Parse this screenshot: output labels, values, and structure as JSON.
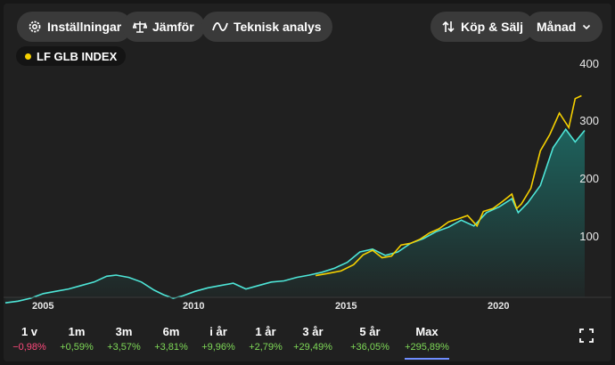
{
  "toolbar": {
    "settings_label": "Inställningar",
    "compare_label": "Jämför",
    "technical_label": "Teknisk analys",
    "buy_sell_label": "Köp & Sälj",
    "interval_label": "Månad"
  },
  "series_label": "LF GLB INDEX",
  "colors": {
    "index_line": "#f5d000",
    "fund_line": "#4ee6d8",
    "fund_fill": "#1d5a56",
    "positive": "#7ed957",
    "negative": "#ff4a7c",
    "active_tab": "#6f8dff"
  },
  "chart_data": {
    "type": "line",
    "y_ticks": [
      "400",
      "300",
      "200",
      "100"
    ],
    "x_ticks": [
      "2005",
      "2010",
      "2015",
      "2020"
    ],
    "ylim": [
      0,
      400
    ],
    "xlim": [
      2004.0,
      2022.3
    ],
    "series": [
      {
        "name": "LF GLB INDEX",
        "color": "#f5d000",
        "x": [
          2013.8,
          2014.2,
          2014.6,
          2015.0,
          2015.3,
          2015.6,
          2015.9,
          2016.2,
          2016.5,
          2016.8,
          2017.1,
          2017.4,
          2017.7,
          2018.0,
          2018.3,
          2018.6,
          2018.9,
          2019.1,
          2019.4,
          2019.7,
          2020.0,
          2020.15,
          2020.3,
          2020.6,
          2020.9,
          2021.2,
          2021.5,
          2021.8,
          2022.0,
          2022.2
        ],
        "values": [
          39,
          43,
          47,
          58,
          75,
          83,
          70,
          73,
          92,
          95,
          102,
          113,
          120,
          132,
          137,
          143,
          125,
          150,
          155,
          167,
          180,
          155,
          163,
          190,
          255,
          283,
          320,
          295,
          345,
          350
        ]
      },
      {
        "series_index": 1,
        "color": "#4ee6d8",
        "x": [
          2004.0,
          2004.4,
          2004.8,
          2005.2,
          2005.6,
          2006.0,
          2006.4,
          2006.8,
          2007.2,
          2007.5,
          2007.9,
          2008.3,
          2008.7,
          2009.0,
          2009.3,
          2009.6,
          2010.0,
          2010.4,
          2010.8,
          2011.2,
          2011.6,
          2012.0,
          2012.4,
          2012.8,
          2013.2,
          2013.6,
          2014.0,
          2014.4,
          2014.8,
          2015.2,
          2015.6,
          2016.0,
          2016.4,
          2016.8,
          2017.2,
          2017.6,
          2018.0,
          2018.4,
          2018.8,
          2019.2,
          2019.6,
          2020.0,
          2020.2,
          2020.5,
          2020.9,
          2021.3,
          2021.7,
          2022.0,
          2022.3
        ],
        "values": [
          -8,
          -5,
          0,
          8,
          12,
          16,
          22,
          28,
          38,
          40,
          36,
          28,
          14,
          6,
          0,
          4,
          12,
          18,
          22,
          26,
          16,
          22,
          28,
          30,
          36,
          40,
          45,
          52,
          62,
          80,
          85,
          74,
          80,
          95,
          103,
          115,
          123,
          135,
          125,
          148,
          158,
          172,
          148,
          165,
          195,
          260,
          292,
          270,
          290
        ]
      }
    ]
  },
  "periods": [
    {
      "label": "1 v",
      "change": "−0,98%",
      "sign": "negative"
    },
    {
      "label": "1m",
      "change": "+0,59%",
      "sign": "positive"
    },
    {
      "label": "3m",
      "change": "+3,57%",
      "sign": "positive"
    },
    {
      "label": "6m",
      "change": "+3,81%",
      "sign": "positive"
    },
    {
      "label": "i år",
      "change": "+9,96%",
      "sign": "positive"
    },
    {
      "label": "1 år",
      "change": "+2,79%",
      "sign": "positive"
    },
    {
      "label": "3 år",
      "change": "+29,49%",
      "sign": "positive"
    },
    {
      "label": "5 år",
      "change": "+36,05%",
      "sign": "positive"
    },
    {
      "label": "Max",
      "change": "+295,89%",
      "sign": "positive",
      "active": true
    }
  ]
}
